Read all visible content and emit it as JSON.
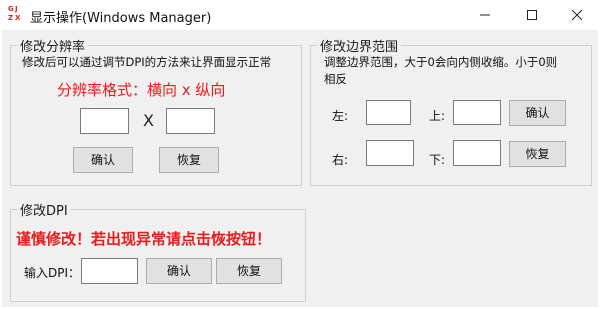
{
  "window": {
    "title": "显示操作(Windows Manager)",
    "icon_letters": [
      "G",
      "J",
      "Z",
      "X"
    ],
    "accent_red": "#e81c1c"
  },
  "resolution_group": {
    "legend": "修改分辨率",
    "description": "修改后可以通过调节DPI的方法来让界面显示正常",
    "format_label": "分辨率格式：横向 x 纵向",
    "width_value": "",
    "separator": "X",
    "height_value": "",
    "confirm_label": "确认",
    "restore_label": "恢复"
  },
  "border_group": {
    "legend": "修改边界范围",
    "description_line1": "调整边界范围，大于0会向内侧收缩。小于0则",
    "description_line2": "相反",
    "left_label": "左:",
    "left_value": "",
    "top_label": "上:",
    "top_value": "",
    "right_label": "右:",
    "right_value": "",
    "bottom_label": "下:",
    "bottom_value": "",
    "confirm_label": "确认",
    "restore_label": "恢复"
  },
  "dpi_group": {
    "legend": "修改DPI",
    "warning": "谨慎修改！若出现异常请点击恢按钮！",
    "input_label": "输入DPI：",
    "dpi_value": "",
    "confirm_label": "确认",
    "restore_label": "恢复"
  }
}
